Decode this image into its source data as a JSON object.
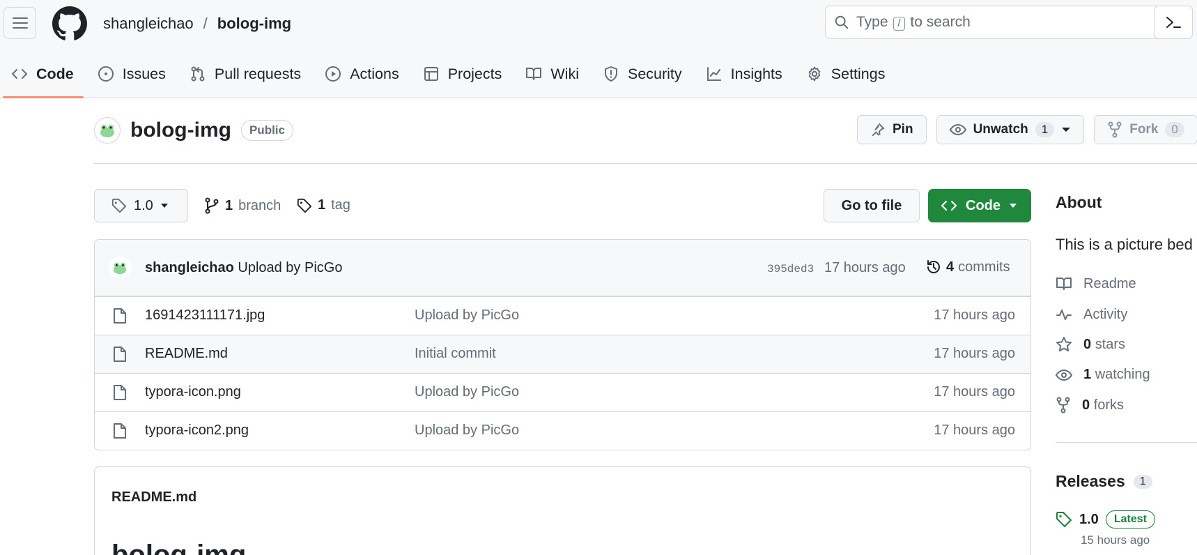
{
  "header": {
    "owner": "shangleichao",
    "separator": "/",
    "repo": "bolog-img",
    "search": {
      "prefix": "Type",
      "key": "/",
      "suffix": "to search"
    }
  },
  "tabs": [
    {
      "label": "Code",
      "icon": "code-icon",
      "active": true
    },
    {
      "label": "Issues",
      "icon": "issue-opened-icon"
    },
    {
      "label": "Pull requests",
      "icon": "git-pull-request-icon"
    },
    {
      "label": "Actions",
      "icon": "play-icon"
    },
    {
      "label": "Projects",
      "icon": "table-icon"
    },
    {
      "label": "Wiki",
      "icon": "book-icon"
    },
    {
      "label": "Security",
      "icon": "shield-icon"
    },
    {
      "label": "Insights",
      "icon": "graph-icon"
    },
    {
      "label": "Settings",
      "icon": "gear-icon"
    }
  ],
  "repo_header": {
    "name": "bolog-img",
    "visibility": "Public",
    "pin_label": "Pin",
    "watch_label": "Unwatch",
    "watch_count": "1",
    "fork_label": "Fork",
    "fork_count": "0"
  },
  "branch_bar": {
    "ref": "1.0",
    "branch_count": "1",
    "branch_label": "branch",
    "tag_count": "1",
    "tag_label": "tag",
    "go_to_file": "Go to file",
    "code_button": "Code"
  },
  "latest_commit": {
    "author": "shangleichao",
    "message": "Upload by PicGo",
    "sha": "395ded3",
    "when": "17 hours ago",
    "commit_count": "4",
    "commit_label": "commits"
  },
  "files": [
    {
      "name": "1691423111171.jpg",
      "message": "Upload by PicGo",
      "when": "17 hours ago"
    },
    {
      "name": "README.md",
      "message": "Initial commit",
      "when": "17 hours ago"
    },
    {
      "name": "typora-icon.png",
      "message": "Upload by PicGo",
      "when": "17 hours ago"
    },
    {
      "name": "typora-icon2.png",
      "message": "Upload by PicGo",
      "when": "17 hours ago"
    }
  ],
  "readme": {
    "title": "README.md",
    "heading": "bolog-img"
  },
  "about": {
    "title": "About",
    "description": "This is a picture bed",
    "readme": "Readme",
    "activity": "Activity",
    "stars_count": "0",
    "stars_label": "stars",
    "watching_count": "1",
    "watching_label": "watching",
    "forks_count": "0",
    "forks_label": "forks"
  },
  "releases": {
    "title": "Releases",
    "count": "1",
    "version": "1.0",
    "badge": "Latest",
    "when": "15 hours ago"
  },
  "colors": {
    "primary_button": "#1f883d",
    "active_tab_underline": "#fd8c73",
    "latest_badge": "#1a7f37"
  }
}
